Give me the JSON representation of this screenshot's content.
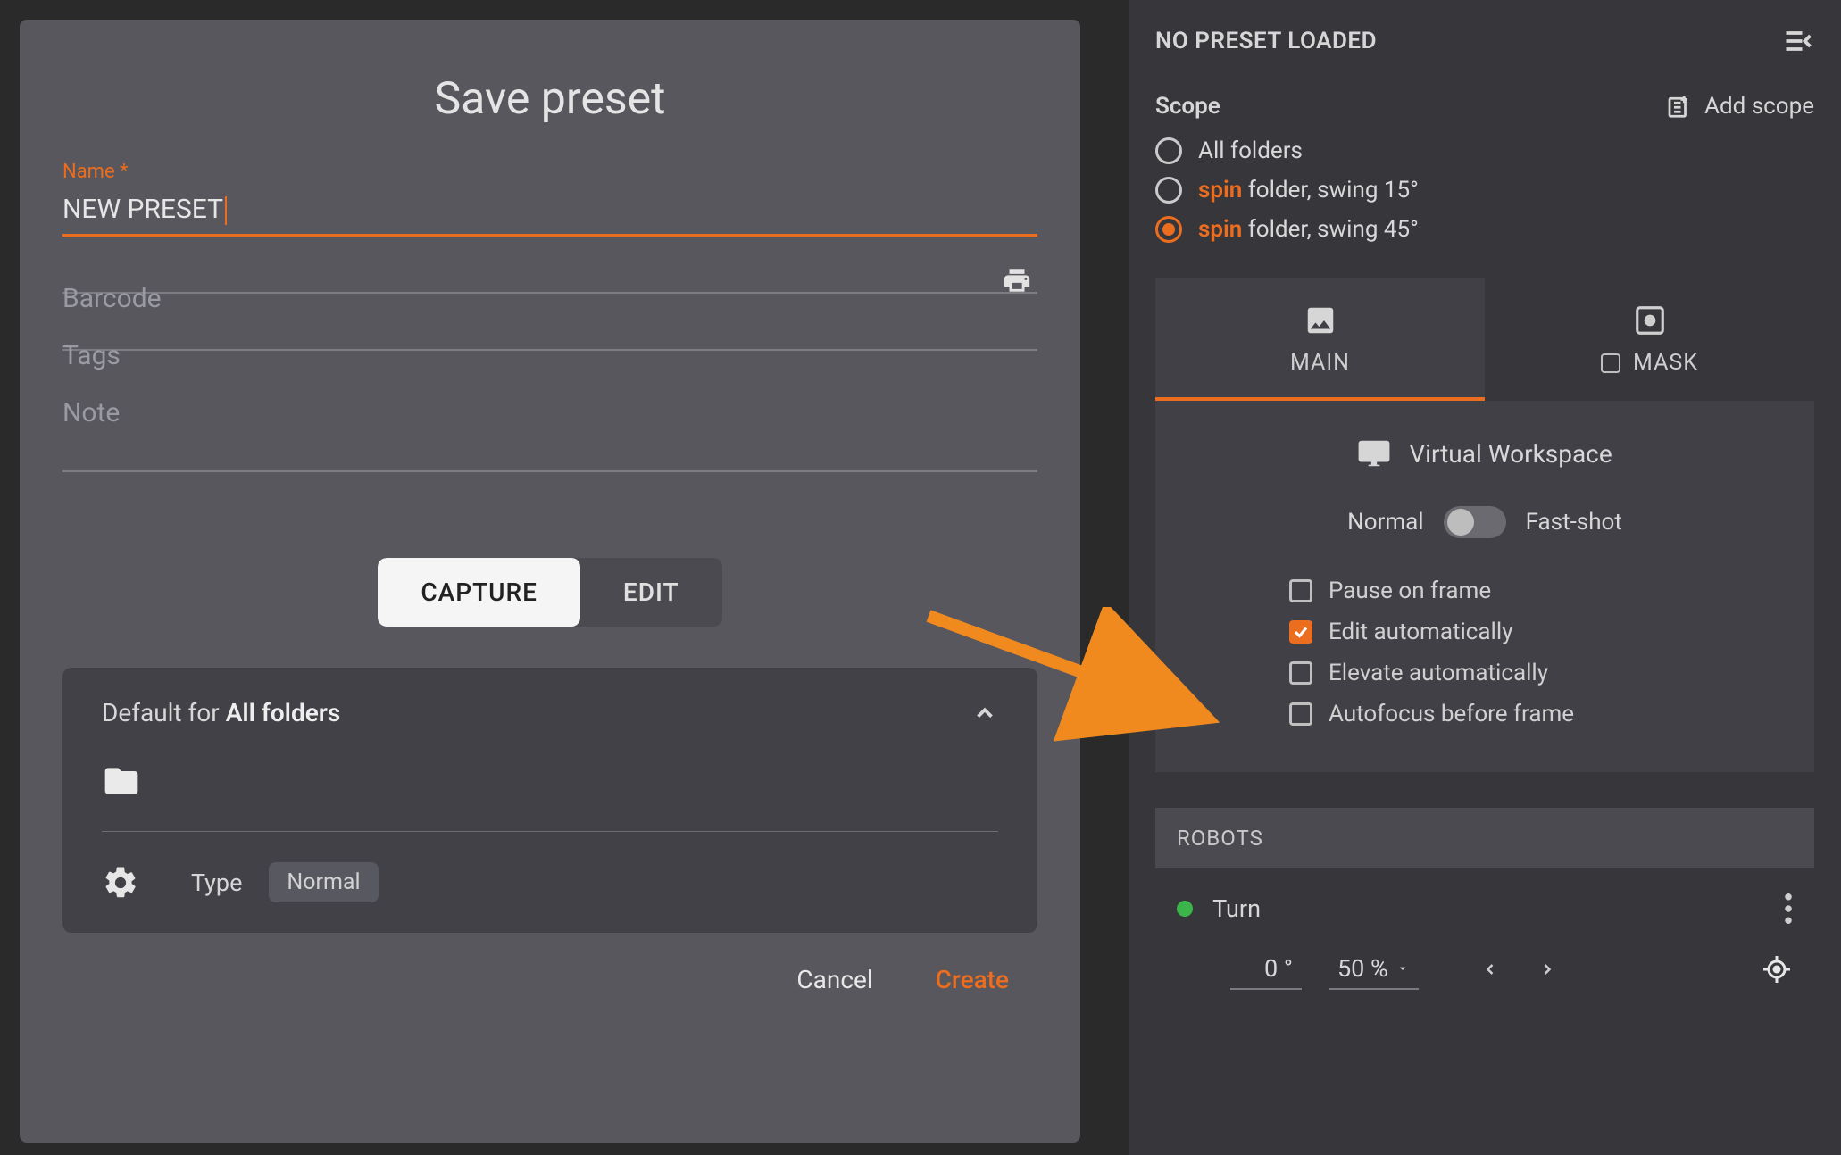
{
  "colors": {
    "accent": "#eb6d1f",
    "bg_modal": "#57575d",
    "bg_panel": "#36363b"
  },
  "modal": {
    "title": "Save preset",
    "name_label": "Name *",
    "name_value": "NEW PRESET",
    "barcode_placeholder": "Barcode",
    "tags_placeholder": "Tags",
    "note_placeholder": "Note",
    "segmented": {
      "capture": "CAPTURE",
      "edit": "EDIT"
    },
    "default_card": {
      "prefix": "Default for ",
      "target": "All folders",
      "type_label": "Type",
      "type_value": "Normal"
    },
    "actions": {
      "cancel": "Cancel",
      "create": "Create"
    }
  },
  "panel": {
    "header_title": "NO PRESET LOADED",
    "scope_label": "Scope",
    "add_scope": "Add scope",
    "scopes": [
      {
        "plain": "All folders",
        "highlight": "",
        "suffix": "",
        "selected": false
      },
      {
        "plain": "",
        "highlight": "spin",
        "suffix": " folder, swing 15°",
        "selected": false
      },
      {
        "plain": "",
        "highlight": "spin",
        "suffix": " folder, swing 45°",
        "selected": true
      }
    ],
    "tabs": {
      "main": "MAIN",
      "mask": "MASK"
    },
    "workspace": {
      "title": "Virtual Workspace",
      "toggle_left": "Normal",
      "toggle_right": "Fast-shot",
      "checkboxes": [
        {
          "label": "Pause on frame",
          "checked": false
        },
        {
          "label": "Edit automatically",
          "checked": true
        },
        {
          "label": "Elevate automatically",
          "checked": false
        },
        {
          "label": "Autofocus before frame",
          "checked": false
        }
      ]
    },
    "robots": {
      "header": "ROBOTS",
      "item": "Turn",
      "angle": "0 °",
      "speed": "50 %"
    }
  }
}
